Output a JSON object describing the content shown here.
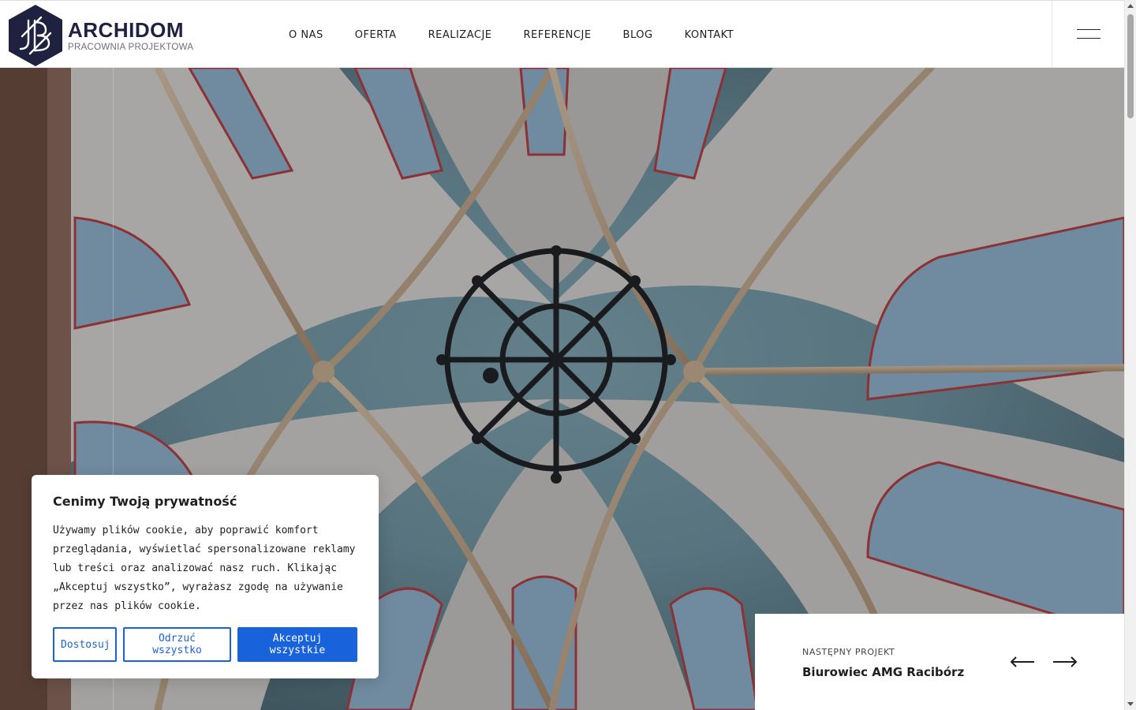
{
  "logo": {
    "title": "ARCHIDOM",
    "subtitle": "PRACOWNIA PROJEKTOWA",
    "color": "#1e2240"
  },
  "nav": {
    "items": [
      {
        "label": "O NAS"
      },
      {
        "label": "OFERTA"
      },
      {
        "label": "REALIZACJE"
      },
      {
        "label": "REFERENCJE"
      },
      {
        "label": "BLOG"
      },
      {
        "label": "KONTAKT"
      }
    ]
  },
  "cookie": {
    "title": "Cenimy Twoją prywatność",
    "text": "Używamy plików cookie, aby poprawić komfort przeglądania, wyświetlać spersonalizowane reklamy lub treści oraz analizować nasz ruch. Klikając „Akceptuj wszystko”, wyrażasz zgodę na używanie przez nas plików cookie.",
    "customize_label": "Dostosuj",
    "reject_label": "Odrzuć wszystko",
    "accept_label": "Akceptuj wszystkie",
    "accent": "#1863dc"
  },
  "next_project": {
    "label": "NASTĘPNY PROJEKT",
    "title": "Biurowiec AMG Racibórz"
  },
  "icons": {
    "menu": "hamburger-icon",
    "prev": "arrow-left-icon",
    "next": "arrow-right-icon"
  }
}
